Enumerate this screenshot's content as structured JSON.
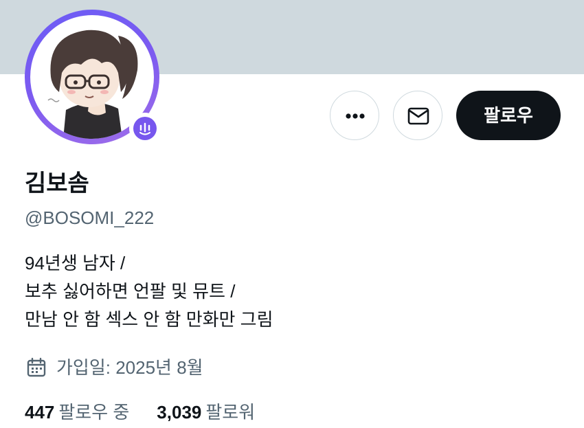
{
  "profile": {
    "display_name": "김보솜",
    "handle": "@BOSOMI_222",
    "bio": [
      "94년생 남자 /",
      "보추 싫어하면 언팔 및 뮤트 /",
      "만남 안 함 섹스 안 함 만화만 그림"
    ],
    "joined": "가입일: 2025년 8월",
    "following_count": "447",
    "following_label": "팔로우 중",
    "followers_count": "3,039",
    "followers_label": "팔로워"
  },
  "actions": {
    "more_icon": "more-horizontal-icon",
    "message_icon": "envelope-icon",
    "follow_label": "팔로우"
  },
  "icons": {
    "calendar": "calendar-icon",
    "voice_badge": "voice-wave-icon"
  },
  "colors": {
    "banner": "#cfd9de",
    "avatar_ring": "#7757ee",
    "follow_button_bg": "#0f1419",
    "secondary_text": "#536471"
  }
}
